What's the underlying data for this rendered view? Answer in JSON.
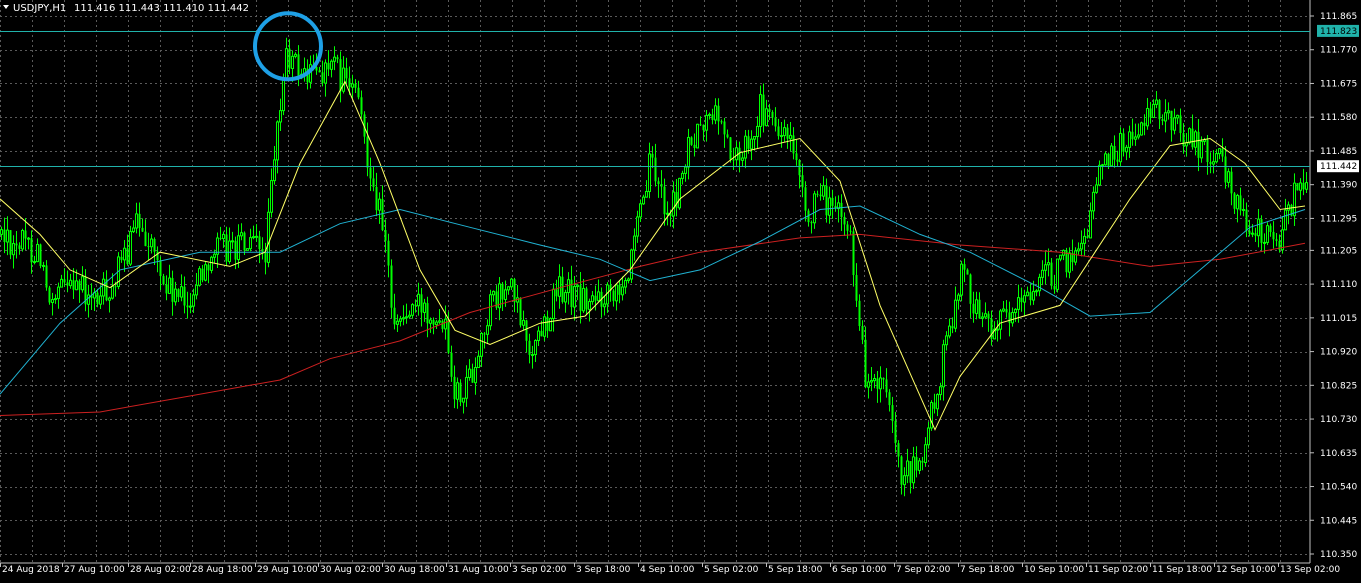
{
  "header": {
    "symbol": "USDJPY,H1",
    "ohlc": "111.416 111.443 111.410 111.442"
  },
  "colors": {
    "background": "#000000",
    "grid": "#5a5a5a",
    "bull_candle": "#00ff00",
    "hline": "#20b2aa",
    "ma_fast": "#ffff66",
    "ma_mid": "#20b2d2",
    "ma_slow": "#cc2020",
    "circle": "#1ea0e6",
    "axis_text": "#ffffff"
  },
  "price_axis": {
    "ticks": [
      "111.865",
      "111.770",
      "111.675",
      "111.580",
      "111.485",
      "111.390",
      "111.295",
      "111.205",
      "111.110",
      "111.015",
      "110.920",
      "110.825",
      "110.730",
      "110.635",
      "110.540",
      "110.445",
      "110.350"
    ]
  },
  "time_axis": {
    "ticks": [
      "24 Aug 2018",
      "27 Aug 10:00",
      "28 Aug 02:00",
      "28 Aug 18:00",
      "29 Aug 10:00",
      "30 Aug 02:00",
      "30 Aug 18:00",
      "31 Aug 10:00",
      "3 Sep 02:00",
      "3 Sep 18:00",
      "4 Sep 10:00",
      "5 Sep 02:00",
      "5 Sep 18:00",
      "6 Sep 10:00",
      "7 Sep 02:00",
      "7 Sep 18:00",
      "10 Sep 10:00",
      "11 Sep 02:00",
      "11 Sep 18:00",
      "12 Sep 10:00",
      "13 Sep 02:00"
    ]
  },
  "price_labels": [
    {
      "name": "upper-hline-label",
      "text": "111.823",
      "value": 111.823,
      "box": "#20b2aa",
      "color": "#000000"
    },
    {
      "name": "current-price-label",
      "text": "111.442",
      "value": 111.442,
      "box": "#ffffff",
      "color": "#000000"
    }
  ],
  "chart_data": {
    "type": "candlestick",
    "symbol": "USDJPY",
    "timeframe": "H1",
    "ylim": [
      110.35,
      111.905
    ],
    "horizontal_lines": [
      111.823,
      111.442
    ],
    "highlight_circle": {
      "time": "29 Aug 10:00",
      "price": 111.78
    },
    "anchors": [
      {
        "x": 0,
        "y": 111.25
      },
      {
        "x": 40,
        "y": 111.2
      },
      {
        "x": 50,
        "y": 111.02
      },
      {
        "x": 70,
        "y": 111.15
      },
      {
        "x": 90,
        "y": 111.05
      },
      {
        "x": 115,
        "y": 111.12
      },
      {
        "x": 140,
        "y": 111.3
      },
      {
        "x": 165,
        "y": 111.1
      },
      {
        "x": 185,
        "y": 111.05
      },
      {
        "x": 210,
        "y": 111.2
      },
      {
        "x": 240,
        "y": 111.22
      },
      {
        "x": 265,
        "y": 111.2
      },
      {
        "x": 285,
        "y": 111.75
      },
      {
        "x": 305,
        "y": 111.7
      },
      {
        "x": 330,
        "y": 111.72
      },
      {
        "x": 355,
        "y": 111.65
      },
      {
        "x": 380,
        "y": 111.3
      },
      {
        "x": 395,
        "y": 111.0
      },
      {
        "x": 420,
        "y": 111.05
      },
      {
        "x": 445,
        "y": 111.02
      },
      {
        "x": 455,
        "y": 110.8
      },
      {
        "x": 470,
        "y": 110.85
      },
      {
        "x": 490,
        "y": 111.05
      },
      {
        "x": 510,
        "y": 111.1
      },
      {
        "x": 530,
        "y": 110.92
      },
      {
        "x": 560,
        "y": 111.1
      },
      {
        "x": 590,
        "y": 111.05
      },
      {
        "x": 610,
        "y": 111.1
      },
      {
        "x": 630,
        "y": 111.15
      },
      {
        "x": 650,
        "y": 111.45
      },
      {
        "x": 670,
        "y": 111.3
      },
      {
        "x": 690,
        "y": 111.5
      },
      {
        "x": 715,
        "y": 111.6
      },
      {
        "x": 735,
        "y": 111.45
      },
      {
        "x": 760,
        "y": 111.6
      },
      {
        "x": 790,
        "y": 111.5
      },
      {
        "x": 805,
        "y": 111.3
      },
      {
        "x": 825,
        "y": 111.35
      },
      {
        "x": 850,
        "y": 111.25
      },
      {
        "x": 865,
        "y": 110.85
      },
      {
        "x": 885,
        "y": 110.8
      },
      {
        "x": 900,
        "y": 110.55
      },
      {
        "x": 920,
        "y": 110.6
      },
      {
        "x": 940,
        "y": 110.85
      },
      {
        "x": 960,
        "y": 111.15
      },
      {
        "x": 985,
        "y": 111.0
      },
      {
        "x": 1010,
        "y": 111.0
      },
      {
        "x": 1030,
        "y": 111.1
      },
      {
        "x": 1060,
        "y": 111.15
      },
      {
        "x": 1085,
        "y": 111.25
      },
      {
        "x": 1100,
        "y": 111.45
      },
      {
        "x": 1120,
        "y": 111.5
      },
      {
        "x": 1140,
        "y": 111.55
      },
      {
        "x": 1160,
        "y": 111.6
      },
      {
        "x": 1180,
        "y": 111.55
      },
      {
        "x": 1200,
        "y": 111.5
      },
      {
        "x": 1220,
        "y": 111.45
      },
      {
        "x": 1235,
        "y": 111.35
      },
      {
        "x": 1255,
        "y": 111.25
      },
      {
        "x": 1280,
        "y": 111.25
      },
      {
        "x": 1300,
        "y": 111.4
      },
      {
        "x": 1308,
        "y": 111.44
      }
    ],
    "ma_fast": [
      {
        "x": 0,
        "y": 111.35
      },
      {
        "x": 40,
        "y": 111.25
      },
      {
        "x": 70,
        "y": 111.15
      },
      {
        "x": 110,
        "y": 111.1
      },
      {
        "x": 160,
        "y": 111.2
      },
      {
        "x": 230,
        "y": 111.16
      },
      {
        "x": 265,
        "y": 111.2
      },
      {
        "x": 300,
        "y": 111.45
      },
      {
        "x": 345,
        "y": 111.68
      },
      {
        "x": 380,
        "y": 111.45
      },
      {
        "x": 420,
        "y": 111.15
      },
      {
        "x": 455,
        "y": 110.98
      },
      {
        "x": 490,
        "y": 110.94
      },
      {
        "x": 540,
        "y": 111.0
      },
      {
        "x": 585,
        "y": 111.02
      },
      {
        "x": 630,
        "y": 111.15
      },
      {
        "x": 680,
        "y": 111.35
      },
      {
        "x": 740,
        "y": 111.48
      },
      {
        "x": 800,
        "y": 111.52
      },
      {
        "x": 840,
        "y": 111.4
      },
      {
        "x": 880,
        "y": 111.05
      },
      {
        "x": 935,
        "y": 110.7
      },
      {
        "x": 960,
        "y": 110.85
      },
      {
        "x": 1000,
        "y": 111.0
      },
      {
        "x": 1060,
        "y": 111.05
      },
      {
        "x": 1095,
        "y": 111.2
      },
      {
        "x": 1130,
        "y": 111.35
      },
      {
        "x": 1170,
        "y": 111.5
      },
      {
        "x": 1210,
        "y": 111.52
      },
      {
        "x": 1245,
        "y": 111.45
      },
      {
        "x": 1280,
        "y": 111.32
      },
      {
        "x": 1305,
        "y": 111.33
      }
    ],
    "ma_mid": [
      {
        "x": 0,
        "y": 110.8
      },
      {
        "x": 60,
        "y": 111.0
      },
      {
        "x": 120,
        "y": 111.15
      },
      {
        "x": 200,
        "y": 111.2
      },
      {
        "x": 280,
        "y": 111.2
      },
      {
        "x": 340,
        "y": 111.28
      },
      {
        "x": 400,
        "y": 111.32
      },
      {
        "x": 470,
        "y": 111.27
      },
      {
        "x": 540,
        "y": 111.22
      },
      {
        "x": 600,
        "y": 111.18
      },
      {
        "x": 650,
        "y": 111.12
      },
      {
        "x": 700,
        "y": 111.15
      },
      {
        "x": 760,
        "y": 111.23
      },
      {
        "x": 820,
        "y": 111.32
      },
      {
        "x": 860,
        "y": 111.33
      },
      {
        "x": 920,
        "y": 111.25
      },
      {
        "x": 970,
        "y": 111.2
      },
      {
        "x": 1040,
        "y": 111.1
      },
      {
        "x": 1090,
        "y": 111.02
      },
      {
        "x": 1150,
        "y": 111.03
      },
      {
        "x": 1200,
        "y": 111.15
      },
      {
        "x": 1250,
        "y": 111.27
      },
      {
        "x": 1305,
        "y": 111.32
      }
    ],
    "ma_slow": [
      {
        "x": 0,
        "y": 110.74
      },
      {
        "x": 100,
        "y": 110.75
      },
      {
        "x": 180,
        "y": 110.79
      },
      {
        "x": 280,
        "y": 110.84
      },
      {
        "x": 330,
        "y": 110.9
      },
      {
        "x": 400,
        "y": 110.95
      },
      {
        "x": 470,
        "y": 111.03
      },
      {
        "x": 560,
        "y": 111.1
      },
      {
        "x": 640,
        "y": 111.16
      },
      {
        "x": 700,
        "y": 111.2
      },
      {
        "x": 800,
        "y": 111.24
      },
      {
        "x": 860,
        "y": 111.25
      },
      {
        "x": 960,
        "y": 111.22
      },
      {
        "x": 1060,
        "y": 111.2
      },
      {
        "x": 1150,
        "y": 111.16
      },
      {
        "x": 1220,
        "y": 111.18
      },
      {
        "x": 1305,
        "y": 111.225
      }
    ]
  }
}
